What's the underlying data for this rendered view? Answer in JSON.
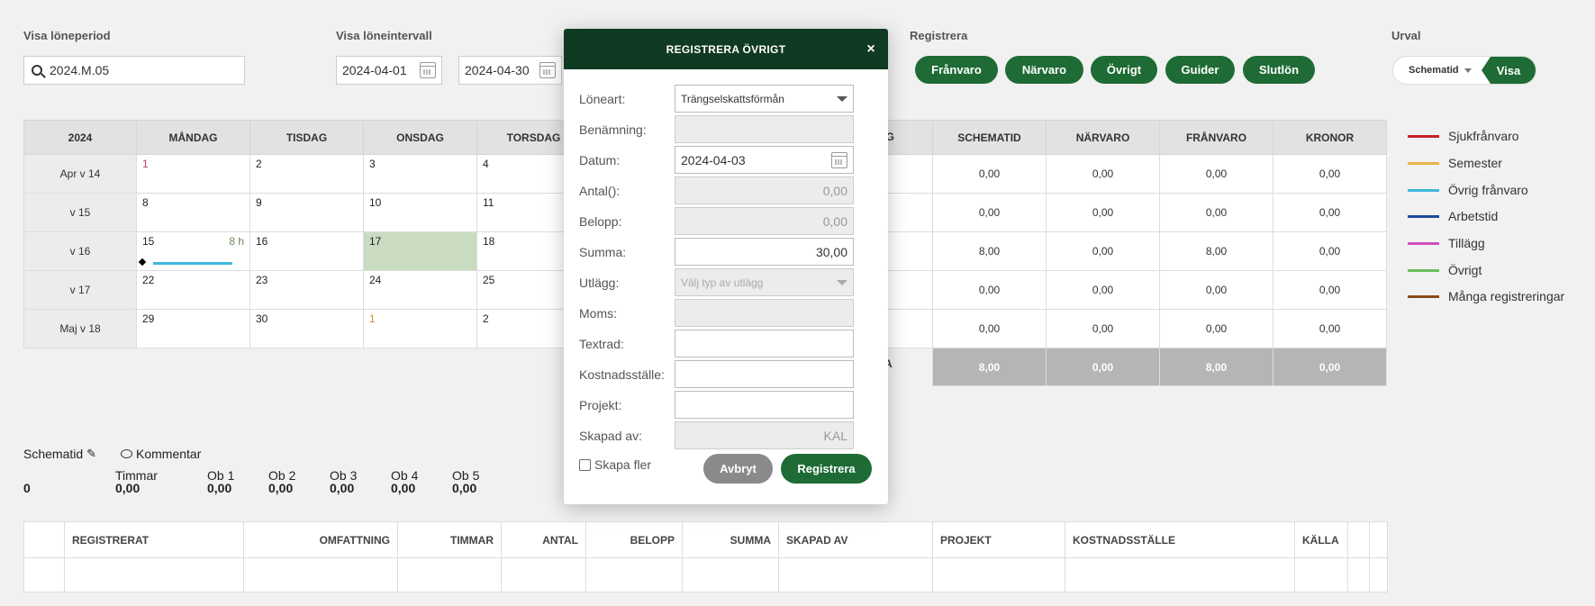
{
  "top": {
    "period_label": "Visa löneperiod",
    "period_value": "2024.M.05",
    "interval_label": "Visa löneintervall",
    "interval_from": "2024-04-01",
    "interval_to": "2024-04-30",
    "register_label": "Registrera",
    "register_buttons": [
      "Frånvaro",
      "Närvaro",
      "Övrigt",
      "Guider",
      "Slutlön"
    ],
    "urval_label": "Urval",
    "urval_select": "Schematid",
    "urval_button": "Visa"
  },
  "calendar": {
    "year": "2024",
    "days": [
      "MÅNDAG",
      "TISDAG",
      "ONSDAG",
      "TORSDAG"
    ],
    "partial_day_suffix": "AG",
    "weeks": [
      {
        "label": "Apr v 14",
        "dates": [
          "1",
          "2",
          "3",
          "4"
        ]
      },
      {
        "label": "v 15",
        "dates": [
          "8",
          "9",
          "10",
          "11"
        ]
      },
      {
        "label": "v 16",
        "dates": [
          "15",
          "16",
          "17",
          "18"
        ],
        "hours": "8 h"
      },
      {
        "label": "v 17",
        "dates": [
          "22",
          "23",
          "24",
          "25"
        ]
      },
      {
        "label": "Maj v 18",
        "dates": [
          "29",
          "30",
          "1",
          "2"
        ]
      }
    ],
    "total_suffix": "A"
  },
  "summary": {
    "headers": [
      "SCHEMATID",
      "NÄRVARO",
      "FRÅNVARO",
      "KRONOR"
    ],
    "rows": [
      [
        "0,00",
        "0,00",
        "0,00",
        "0,00"
      ],
      [
        "0,00",
        "0,00",
        "0,00",
        "0,00"
      ],
      [
        "8,00",
        "0,00",
        "8,00",
        "0,00"
      ],
      [
        "0,00",
        "0,00",
        "0,00",
        "0,00"
      ],
      [
        "0,00",
        "0,00",
        "0,00",
        "0,00"
      ]
    ],
    "total": [
      "8,00",
      "0,00",
      "8,00",
      "0,00"
    ]
  },
  "legend": [
    {
      "label": "Sjukfrånvaro",
      "color": "#c8202a"
    },
    {
      "label": "Semester",
      "color": "#e8b34c"
    },
    {
      "label": "Övrig frånvaro",
      "color": "#3fb8de"
    },
    {
      "label": "Arbetstid",
      "color": "#1c4a9c"
    },
    {
      "label": "Tillägg",
      "color": "#d14fc0"
    },
    {
      "label": "Övrigt",
      "color": "#6abf5a"
    },
    {
      "label": "Många registreringar",
      "color": "#8b4a1c"
    }
  ],
  "info": {
    "schematid": "Schematid",
    "kommentar": "Kommentar",
    "zero": "0",
    "cols": [
      {
        "label": "Timmar",
        "value": "0,00"
      },
      {
        "label": "Ob 1",
        "value": "0,00"
      },
      {
        "label": "Ob 2",
        "value": "0,00"
      },
      {
        "label": "Ob 3",
        "value": "0,00"
      },
      {
        "label": "Ob 4",
        "value": "0,00"
      },
      {
        "label": "Ob 5",
        "value": "0,00"
      }
    ]
  },
  "bottom_table": {
    "headers": [
      "REGISTRERAT",
      "OMFATTNING",
      "TIMMAR",
      "ANTAL",
      "BELOPP",
      "SUMMA",
      "SKAPAD AV",
      "PROJEKT",
      "KOSTNADSSTÄLLE",
      "KÄLLA"
    ]
  },
  "modal": {
    "title": "REGISTRERA ÖVRIGT",
    "fields": {
      "loneart_label": "Löneart:",
      "loneart_value": "Trängselskattsförmån",
      "benamning_label": "Benämning:",
      "datum_label": "Datum:",
      "datum_value": "2024-04-03",
      "antal_label": "Antal():",
      "antal_value": "0,00",
      "belopp_label": "Belopp:",
      "belopp_value": "0,00",
      "summa_label": "Summa:",
      "summa_value": "30,00",
      "utlagg_label": "Utlägg:",
      "utlagg_placeholder": "Välj typ av utlägg",
      "moms_label": "Moms:",
      "textrad_label": "Textrad:",
      "kostnad_label": "Kostnadsställe:",
      "projekt_label": "Projekt:",
      "skapad_label": "Skapad av:",
      "skapad_value": "KAL"
    },
    "skapa_fler": "Skapa fler",
    "cancel": "Avbryt",
    "submit": "Registrera"
  }
}
